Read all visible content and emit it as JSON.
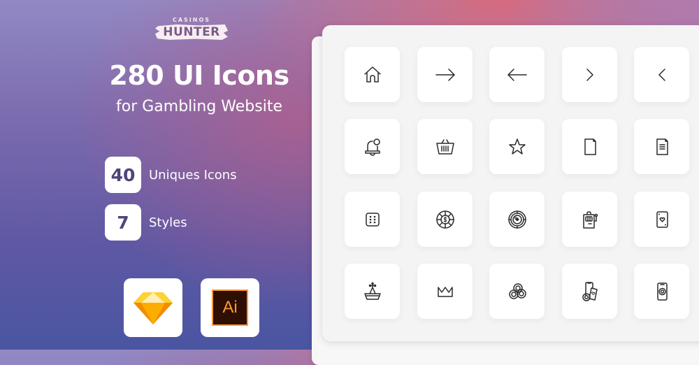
{
  "brand": {
    "top_text": "CASINOS",
    "name": "HUNTER"
  },
  "headline": "280 UI Icons",
  "subheadline": "for Gambling Website",
  "stats": [
    {
      "value": "40",
      "label": "Uniques Icons"
    },
    {
      "value": "7",
      "label": "Styles"
    }
  ],
  "apps": [
    {
      "name": "Sketch",
      "icon": "sketch-diamond-icon"
    },
    {
      "name": "Illustrator",
      "text": "Ai",
      "icon": "adobe-illustrator-icon"
    }
  ],
  "colors": {
    "accent_dark": "#4f4478",
    "ai_orange": "#f79a34",
    "ai_bg": "#2f0f04",
    "sketch_yellow": "#fdb300",
    "icon_stroke": "#2a2a2a"
  },
  "icon_grid": [
    [
      "home-icon",
      "arrow-right-icon",
      "arrow-left-icon",
      "chevron-right-icon",
      "chevron-left-icon"
    ],
    [
      "bell-notification-icon",
      "basket-icon",
      "star-icon",
      "document-blank-icon",
      "document-text-icon"
    ],
    [
      "dice-icon",
      "casino-chip-dollar-icon",
      "casino-chip-clover-icon",
      "slot-machine-icon",
      "playing-card-heart-icon"
    ],
    [
      "sailboat-hat-icon",
      "crown-icon",
      "chips-stack-icon",
      "mobile-cards-chip-icon",
      "mobile-chip-icon"
    ]
  ]
}
